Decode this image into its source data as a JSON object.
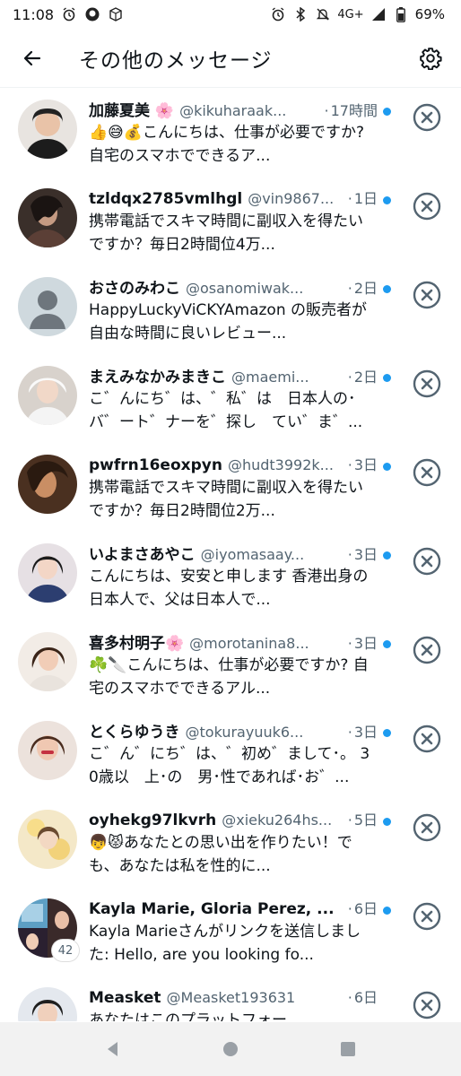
{
  "status_bar": {
    "time": "11:08",
    "network": "4G+",
    "battery": "69%"
  },
  "header": {
    "title": "その他のメッセージ"
  },
  "messages": [
    {
      "name": "加藤夏美 🌸",
      "handle": "@kikuharaak...",
      "sep": "·",
      "time": "17時間",
      "preview": "👍😅💰こんにちは、仕事が必要ですか? 自宅のスマホでできるア...",
      "unread": true
    },
    {
      "name": "tzldqx2785vmlhgl",
      "handle": "@vin9867...",
      "sep": "·",
      "time": "1日",
      "preview": "携帯電話でスキマ時間に副収入を得たいですか？毎日2時間位4万...",
      "unread": true
    },
    {
      "name": "おさのみわこ",
      "handle": "@osanomiwak...",
      "sep": "·",
      "time": "2日",
      "preview": "HappyLuckyViCKYAmazon の販売者が自由な時間に良いレビュー...",
      "unread": true
    },
    {
      "name": "まえみなかみまきこ",
      "handle": "@maemi...",
      "sep": "·",
      "time": "2日",
      "preview": "こ゛んにち゛は、゛私゛は　日本人の･バ゛ート゛ナーを゛探し　てい゛ま゛...",
      "unread": true
    },
    {
      "name": "pwfrn16eoxpyn",
      "handle": "@hudt3992k...",
      "sep": "·",
      "time": "3日",
      "preview": "携帯電話でスキマ時間に副収入を得たいですか？毎日2時間位2万...",
      "unread": true
    },
    {
      "name": "いよまさあやこ",
      "handle": "@iyomasaay...",
      "sep": "·",
      "time": "3日",
      "preview": "こんにちは、安安と申します 香港出身の日本人で、父は日本人で...",
      "unread": true
    },
    {
      "name": "喜多村明子🌸",
      "handle": "@morotanina8...",
      "sep": "·",
      "time": "3日",
      "preview": "☘️🔪こんにちは、仕事が必要ですか? 自宅のスマホでできるアル...",
      "unread": true
    },
    {
      "name": "とくらゆうき",
      "handle": "@tokurayuuk6...",
      "sep": "·",
      "time": "3日",
      "preview": "こ゛ん゛にち゛は、゛初め゛まして･。 30歳以　上･の　男･性であれば･お゛...",
      "unread": true
    },
    {
      "name": "oyhekg97lkvrh",
      "handle": "@xieku264hs...",
      "sep": "·",
      "time": "5日",
      "preview": "👦😾あなたとの思い出を作りたい！でも、あなたは私を性的に...",
      "unread": true
    },
    {
      "name": "Kayla Marie, Gloria Perez, ...",
      "handle": "",
      "sep": "·",
      "time": "6日",
      "preview": "Kayla Marieさんがリンクを送信しました: Hello, are you looking fo...",
      "unread": true,
      "badge": "42"
    },
    {
      "name": "Measket",
      "handle": "@Measket193631",
      "sep": "·",
      "time": "6日",
      "preview": "あなたはこのプラットフォー...",
      "unread": false
    }
  ]
}
